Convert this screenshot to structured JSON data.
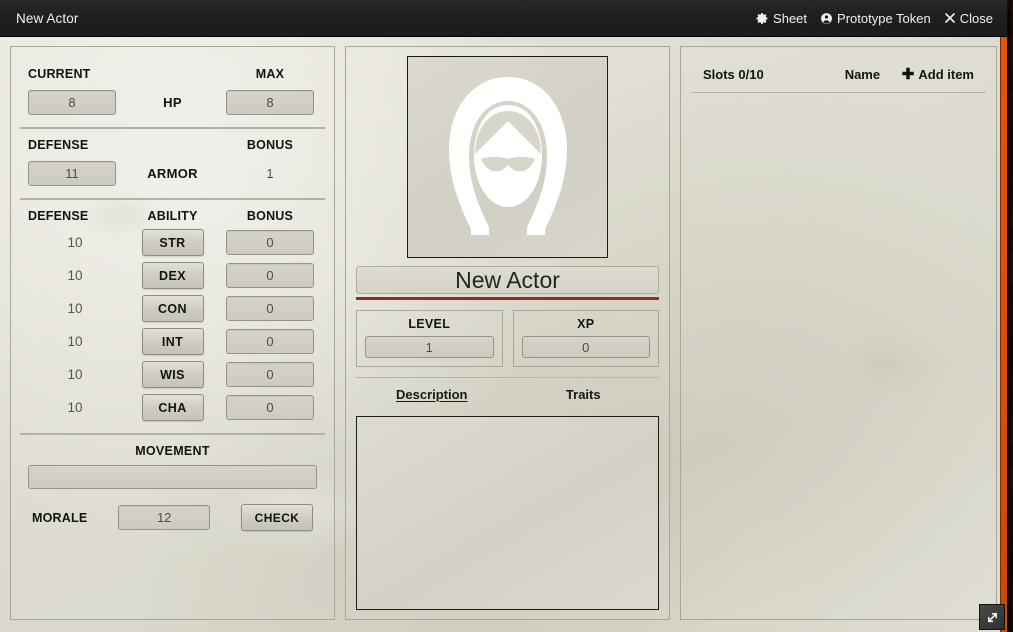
{
  "window": {
    "title": "New Actor",
    "controls": [
      {
        "label": "Sheet",
        "icon": "gear-icon"
      },
      {
        "label": "Prototype Token",
        "icon": "user-circle-icon"
      },
      {
        "label": "Close",
        "icon": "close-icon"
      }
    ]
  },
  "accent_color": "#d8500c",
  "name_rule_color": "#8d2f22",
  "left": {
    "hp": {
      "header_current": "CURRENT",
      "header_mid": "HP",
      "header_max": "MAX",
      "current": "8",
      "max": "8"
    },
    "armor": {
      "header_defense": "DEFENSE",
      "header_mid": "ARMOR",
      "header_bonus": "BONUS",
      "defense": "11",
      "bonus": "1"
    },
    "abilities": {
      "header_defense": "DEFENSE",
      "header_ability": "ABILITY",
      "header_bonus": "BONUS",
      "rows": [
        {
          "defense": "10",
          "label": "STR",
          "bonus": "0"
        },
        {
          "defense": "10",
          "label": "DEX",
          "bonus": "0"
        },
        {
          "defense": "10",
          "label": "CON",
          "bonus": "0"
        },
        {
          "defense": "10",
          "label": "INT",
          "bonus": "0"
        },
        {
          "defense": "10",
          "label": "WIS",
          "bonus": "0"
        },
        {
          "defense": "10",
          "label": "CHA",
          "bonus": "0"
        }
      ]
    },
    "movement": {
      "label": "MOVEMENT",
      "value": "",
      "placeholder": ""
    },
    "morale": {
      "label": "MORALE",
      "value": "12",
      "check_label": "CHECK"
    }
  },
  "middle": {
    "avatar_icon": "hooded-figure-icon",
    "actor_name": "New Actor",
    "level": {
      "label": "LEVEL",
      "value": "1"
    },
    "xp": {
      "label": "XP",
      "value": "0"
    },
    "tabs": [
      {
        "label": "Description",
        "active": true
      },
      {
        "label": "Traits",
        "active": false
      }
    ],
    "description_text": ""
  },
  "right": {
    "slots": "Slots 0/10",
    "name_header": "Name",
    "add_item": "Add item",
    "items": []
  }
}
